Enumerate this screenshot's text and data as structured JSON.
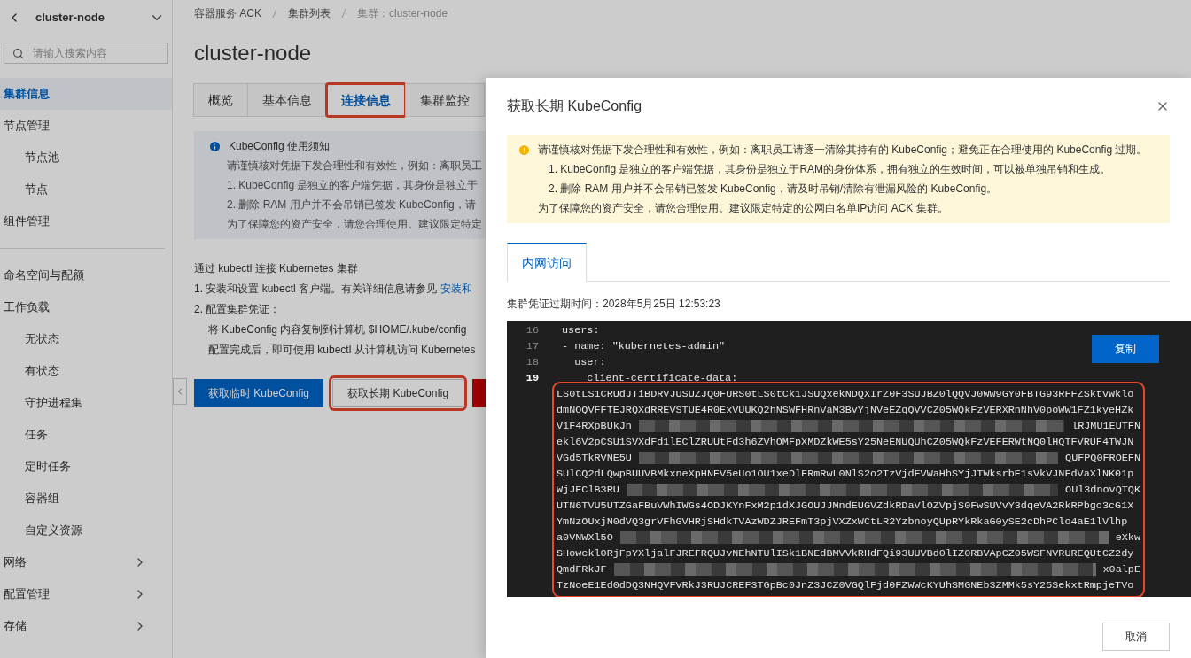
{
  "sidebar": {
    "title": "cluster-node",
    "search": {
      "placeholder": "请输入搜索内容"
    },
    "sections": [
      [
        {
          "label": "集群信息",
          "selected": true
        },
        {
          "label": "节点管理",
          "selected": false,
          "children": [
            {
              "label": "节点池",
              "selected": false
            },
            {
              "label": "节点",
              "selected": false
            }
          ]
        },
        {
          "label": "组件管理",
          "selected": false
        }
      ],
      [
        {
          "label": "命名空间与配额",
          "selected": false
        },
        {
          "label": "工作负载",
          "selected": false,
          "children": [
            {
              "label": "无状态",
              "selected": false
            },
            {
              "label": "有状态",
              "selected": false
            },
            {
              "label": "守护进程集",
              "selected": false
            },
            {
              "label": "任务",
              "selected": false
            },
            {
              "label": "定时任务",
              "selected": false
            },
            {
              "label": "容器组",
              "selected": false
            },
            {
              "label": "自定义资源",
              "selected": false
            }
          ]
        },
        {
          "label": "网络",
          "selected": false,
          "expanded": false
        },
        {
          "label": "配置管理",
          "selected": false,
          "expanded": false
        },
        {
          "label": "存储",
          "selected": false,
          "expanded": false
        }
      ]
    ]
  },
  "breadcrumb": [
    "容器服务 ACK",
    "集群列表",
    "集群：cluster-node"
  ],
  "page_title": "cluster-node",
  "tabs": [
    {
      "label": "概览",
      "selected": false
    },
    {
      "label": "基本信息",
      "selected": false
    },
    {
      "label": "连接信息",
      "selected": true,
      "highlighted": true
    },
    {
      "label": "集群监控",
      "selected": false
    }
  ],
  "notice": {
    "title": "KubeConfig 使用须知",
    "lines": [
      "请谨慎核对凭据下发合理性和有效性，例如：离职员工",
      "1. KubeConfig 是独立的客户端凭据，其身份是独立于",
      "2. 删除 RAM 用户并不会吊销已签发 KubeConfig，请",
      "为了保障您的资产安全，请您合理使用。建议限定特定"
    ]
  },
  "kubectl": {
    "heading": "通过 kubectl 连接 Kubernetes 集群",
    "step1": "1. 安装和设置 kubectl 客户端。有关详细信息请参见",
    "step1_link": "安装和",
    "step2": "2. 配置集群凭证：",
    "step2_lines": [
      "将 KubeConfig 内容复制到计算机 $HOME/.kube/config",
      "配置完成后，即可使用 kubectl 从计算机访问 Kubernetes"
    ]
  },
  "actions": [
    {
      "label": "获取临时 KubeConfig",
      "kind": "primary",
      "highlighted": false
    },
    {
      "label": "获取长期 KubeConfig",
      "kind": "secondary",
      "highlighted": true
    },
    {
      "kind": "danger",
      "highlighted": false
    }
  ],
  "drawer": {
    "title": "获取长期 KubeConfig",
    "alert": [
      "请谨慎核对凭据下发合理性和有效性，例如：离职员工请逐一清除其持有的 KubeConfig；避免正在合理使用的 KubeConfig 过期。",
      "1. KubeConfig 是独立的客户端凭据，其身份是独立于RAM的身份体系，拥有独立的生效时间，可以被单独吊销和生成。",
      "2. 删除 RAM 用户并不会吊销已签发 KubeConfig，请及时吊销/清除有泄漏风险的 KubeConfig。",
      "为了保障您的资产安全，请您合理使用。建议限定特定的公网白名单IP访问 ACK 集群。"
    ],
    "tabs": [
      {
        "label": "内网访问",
        "selected": true
      }
    ],
    "expiry": "集群凭证过期时间：2028年5月25日 12:53:23",
    "copy_button": "复制",
    "code_lines": [
      {
        "number": "16",
        "text": "users:",
        "current": false
      },
      {
        "number": "17",
        "text": "- name: \"kubernetes-admin\"",
        "current": false
      },
      {
        "number": "18",
        "text": "  user:",
        "current": false
      },
      {
        "number": "19",
        "text": "    client-certificate-data:",
        "current": true
      }
    ],
    "data_lines": [
      {
        "kind": "plain",
        "text": "LS0tLS1CRUdJTiBDRVJUSUZJQ0FURS0tLS0tCk1JSUQxekNDQXIrZ0F3SUJBZ0lQQVJ0WW9GY0FBTG93RFFZSktvWklo"
      },
      {
        "kind": "plain",
        "text": "dmNOQVFFTEJRQXdRREVSTUE4R0ExVUUKQ2hNSWFHRnVaM3BvYjNVeEZqQVVCZ05WQkFzVERXRnNhV0poWW1FZ1kyeHZk"
      },
      {
        "kind": "redacted",
        "start": "V1F4RXpBUkJn",
        "end": "lRJMU1EUTFN"
      },
      {
        "kind": "plain",
        "text": "ekl6V2pCSU1SVXdFd1lEClZRUUtFd3h6ZVhOMFpXMDZkWE5sY25NeENUQUhCZ05WQkFzVEFERWtNQ0lHQTFVRUF4TWJN"
      },
      {
        "kind": "redacted",
        "start": "VGd5TkRVNE5U",
        "end": "QUFPQ0FROEFN"
      },
      {
        "kind": "plain",
        "text": "SUlCQ2dLQwpBUUVBMkxneXpHNEV5eUo1OU1xeDlFRmRwL0NlS2o2TzVjdFVWaHhSYjJTWksrbE1sVkVJNFdVaXlNK01p"
      },
      {
        "kind": "redacted",
        "start": "WjJEClB3RU",
        "end": "OUl3dnovQTQK"
      },
      {
        "kind": "plain",
        "text": "UTN6TVU5UTZGaFBuVWhIWGs4ODJKYnFxM2p1dXJGOUJJMndEUGVZdkRDaVlOZVpjS0FwSUVvY3dqeVA2RkRPbgo3cG1X"
      },
      {
        "kind": "plain",
        "text": "YmNzOUxjN0dVQ3grVFhGVHRjSHdkTVAzWDZJREFmT3pjVXZxWCtLR2YzbnoyQUpRYkRkaG0ySE2cDhPClo4aE1lVlhp"
      },
      {
        "kind": "redacted",
        "start": "a0VNWXl5O",
        "end": "eXkw"
      },
      {
        "kind": "plain",
        "text": "SHowckl0RjFpYXljalFJREFRQUJvNEhNTUlISk1BNEdBMVVkRHdFQi93UUVBd0lIZ0RBVApCZ05WSFNVRUREQUtCZ2dy"
      },
      {
        "kind": "redacted",
        "start": "QmdFRkJF",
        "end": "x0alpE"
      },
      {
        "kind": "plain",
        "text": "TzNoeE1Ed0dDQ3NHQVFVRkJ3RUJCREF3TGpBc0JnZ3JCZ0VGQlFjd0FZWWcKYUhSMGNEb3ZMMk5sY25SekxtRmpjeTVo"
      }
    ],
    "data_highlighted": true,
    "cancel_button": "取消"
  }
}
